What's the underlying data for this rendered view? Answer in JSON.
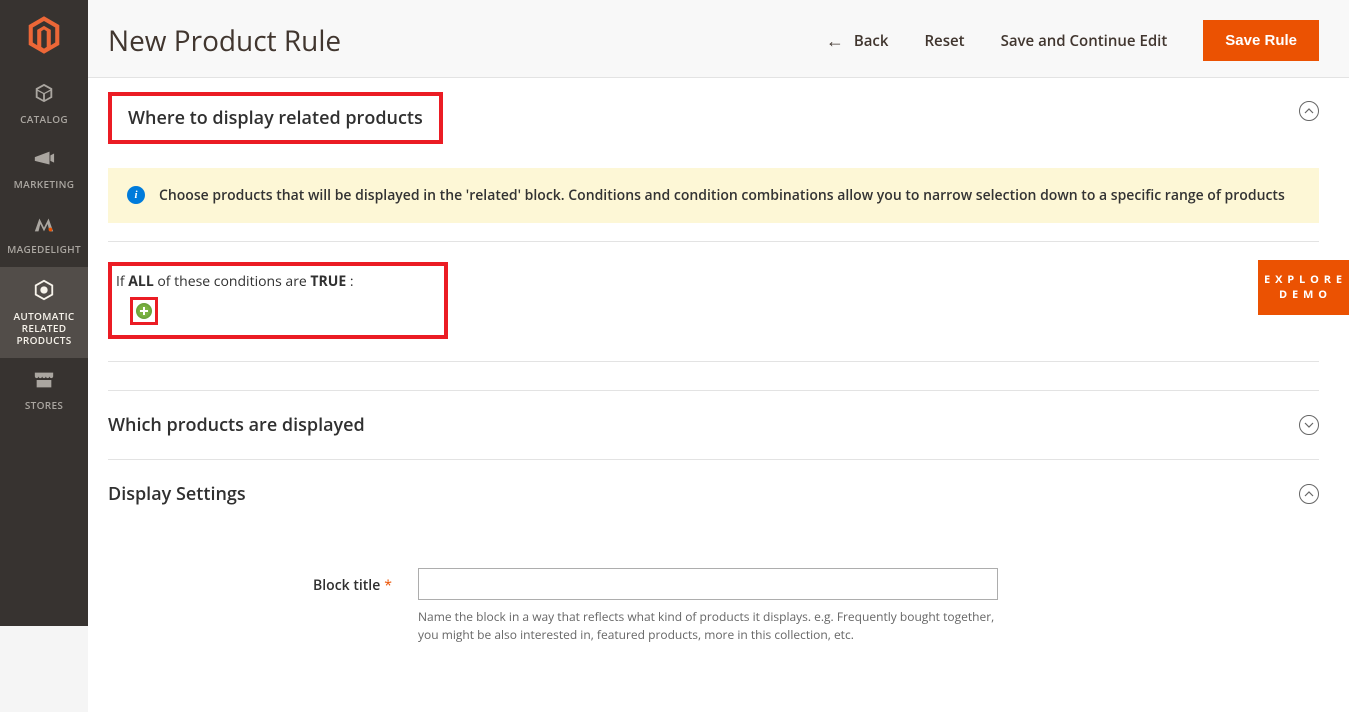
{
  "sidebar": {
    "items": [
      {
        "label": "CATALOG",
        "icon": "cube"
      },
      {
        "label": "MARKETING",
        "icon": "megaphone"
      },
      {
        "label": "MAGEDELIGHT",
        "icon": "md"
      },
      {
        "label": "AUTOMATIC\nRELATED\nPRODUCTS",
        "icon": "hex",
        "active": true
      },
      {
        "label": "STORES",
        "icon": "storefront"
      }
    ]
  },
  "header": {
    "title": "New Product Rule",
    "back": "Back",
    "reset": "Reset",
    "save_continue": "Save and Continue Edit",
    "save": "Save Rule"
  },
  "sections": {
    "where": {
      "title": "Where to display related products",
      "info": "Choose products that will be displayed in the 'related' block. Conditions and condition combinations allow you to narrow selection down to a specific range of products",
      "condition_prefix": "If ",
      "condition_all": "ALL",
      "condition_mid": "  of these conditions are ",
      "condition_true": "TRUE",
      "condition_suffix": " :"
    },
    "which": {
      "title": "Which products are displayed"
    },
    "display": {
      "title": "Display Settings",
      "block_title_label": "Block title",
      "block_title_value": "",
      "block_title_hint": "Name the block in a way that reflects what kind of products it displays. e.g. Frequently bought together, you might be also interested in, featured products, more in this collection, etc."
    }
  },
  "explore": {
    "line1": "E X P L O R E",
    "line2": "D E M O"
  }
}
